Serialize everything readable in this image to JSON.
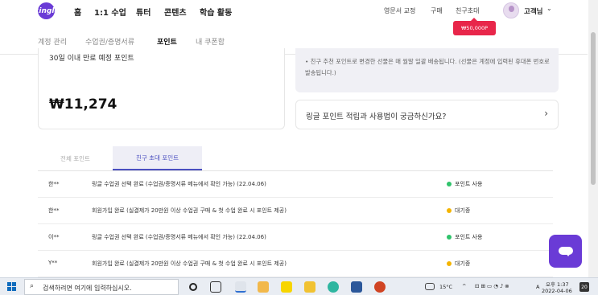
{
  "header": {
    "logo_label": "Ringle",
    "nav": [
      "홈",
      "1:1 수업",
      "튜터",
      "콘텐츠",
      "학습 활동"
    ],
    "util": [
      "영문서 교정",
      "구매",
      "친구초대"
    ],
    "user_name": "고객님",
    "invite_tooltip": "₩50,000P"
  },
  "subtabs": [
    "계정 관리",
    "수업권/증명서류",
    "포인트",
    "내 쿠폰함"
  ],
  "summary": {
    "expire_label": "30일 이내 만료 예정 포인트",
    "points": "₩11,274"
  },
  "notice": "• 친구 추천 포인트로 변경한 선물은 매 월말 일괄 배송됩니다. (선물은 계정에 입력된 휴대폰 번호로 발송됩니다.)",
  "guide": "링글 포인트 적립과 사용법이 궁금하신가요?",
  "history_tabs": [
    "전체 포인트",
    "친구 초대 포인트"
  ],
  "rows": [
    {
      "name": "한**",
      "desc": "링글 수업권 선택 완료 (수업권/증명서류 메뉴에서 확인 가능) (22.04.06)",
      "status": "포인트 사용",
      "color": "#2fc36b"
    },
    {
      "name": "한**",
      "desc": "회원가입 완료 (실결제가 20만원 이상 수업권 구매 & 첫 수업 완료 시 포인트 제공)",
      "status": "대기중",
      "color": "#f4b400"
    },
    {
      "name": "이**",
      "desc": "링글 수업권 선택 완료 (수업권/증명서류 메뉴에서 확인 가능) (22.04.06)",
      "status": "포인트 사용",
      "color": "#2fc36b"
    },
    {
      "name": "Y**",
      "desc": "회원가입 완료 (실결제가 20만원 이상 수업권 구매 & 첫 수업 완료 시 포인트 제공)",
      "status": "대기중",
      "color": "#f4b400"
    }
  ],
  "taskbar": {
    "search_placeholder": "검색하려면 여기에 입력하십시오.",
    "weather": "15°C",
    "ime": "A",
    "time": "오후 1:37",
    "date": "2022-04-06",
    "notifications": "20"
  }
}
